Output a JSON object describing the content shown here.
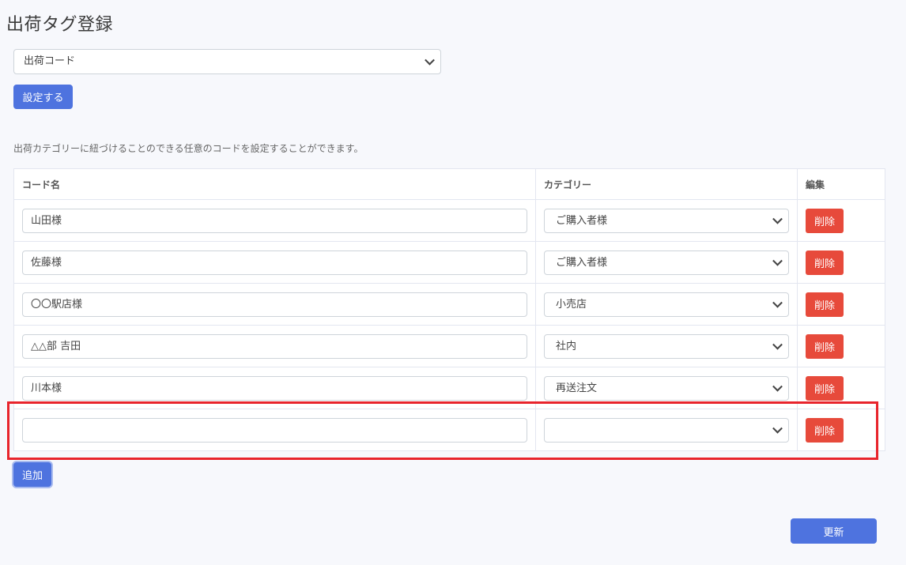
{
  "page_title": "出荷タグ登録",
  "top_select": {
    "value": "出荷コード"
  },
  "set_button_label": "設定する",
  "description": "出荷カテゴリーに紐づけることのできる任意のコードを設定することができます。",
  "table": {
    "headers": [
      "コード名",
      "カテゴリー",
      "編集"
    ],
    "rows": [
      {
        "code": "山田様",
        "category": "ご購入者様",
        "delete_label": "削除"
      },
      {
        "code": "佐藤様",
        "category": "ご購入者様",
        "delete_label": "削除"
      },
      {
        "code": "〇〇駅店様",
        "category": "小売店",
        "delete_label": "削除"
      },
      {
        "code": "△△部 吉田",
        "category": "社内",
        "delete_label": "削除"
      },
      {
        "code": "川本様",
        "category": "再送注文",
        "delete_label": "削除"
      },
      {
        "code": "",
        "category": "",
        "delete_label": "削除"
      }
    ]
  },
  "add_button_label": "追加",
  "update_button_label": "更新",
  "colors": {
    "primary": "#4e73df",
    "danger": "#e74a3b",
    "highlight": "#e8242c",
    "background": "#f7f8fc"
  }
}
